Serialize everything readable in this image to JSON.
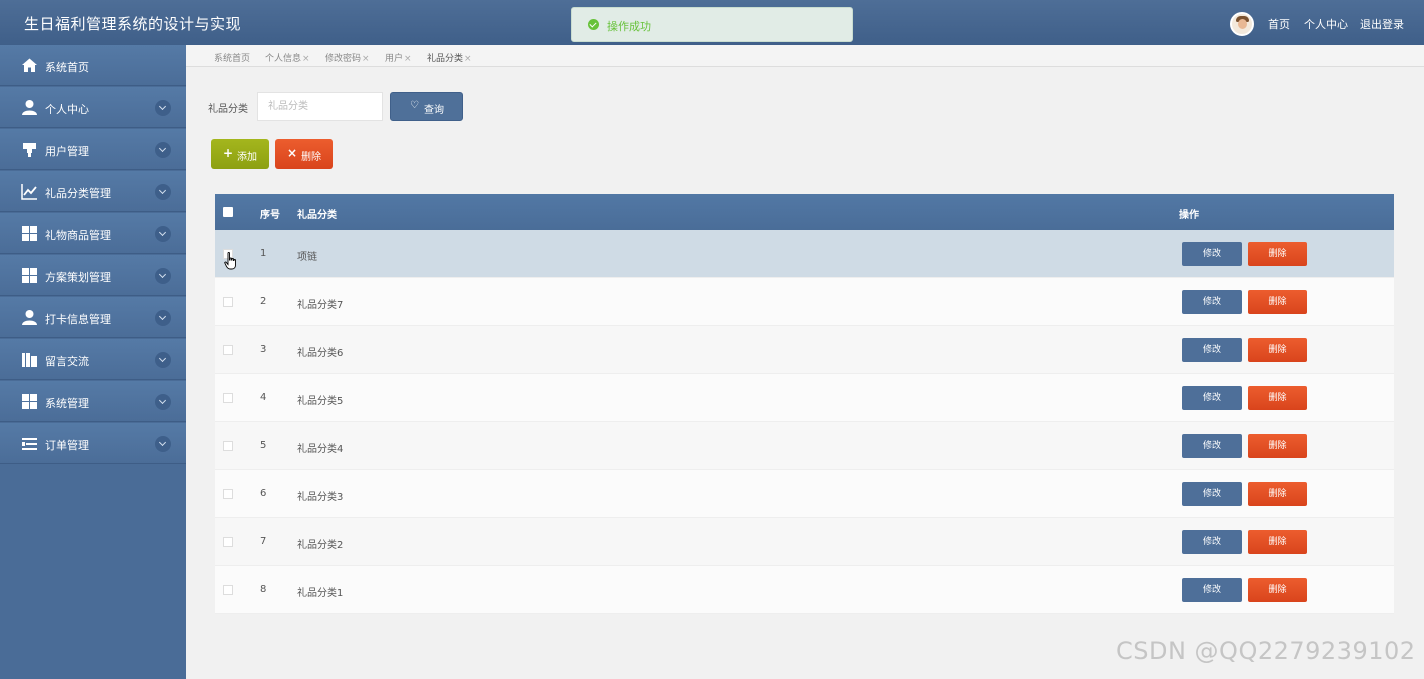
{
  "header": {
    "title": "生日福利管理系统的设计与实现",
    "nav": {
      "home": "首页",
      "profile": "个人中心",
      "logout": "退出登录"
    }
  },
  "toast": {
    "message": "操作成功",
    "color": "#67c23a"
  },
  "sidebar": {
    "items": [
      {
        "label": "系统首页",
        "icon": "home-icon",
        "expandable": false
      },
      {
        "label": "个人中心",
        "icon": "user-icon",
        "expandable": true
      },
      {
        "label": "用户管理",
        "icon": "user-manage-icon",
        "expandable": true
      },
      {
        "label": "礼品分类管理",
        "icon": "chart-icon",
        "expandable": true
      },
      {
        "label": "礼物商品管理",
        "icon": "grid-icon",
        "expandable": true
      },
      {
        "label": "方案策划管理",
        "icon": "grid-icon",
        "expandable": true
      },
      {
        "label": "打卡信息管理",
        "icon": "user-icon",
        "expandable": true
      },
      {
        "label": "留言交流",
        "icon": "message-icon",
        "expandable": true
      },
      {
        "label": "系统管理",
        "icon": "grid-icon",
        "expandable": true
      },
      {
        "label": "订单管理",
        "icon": "list-icon",
        "expandable": true
      }
    ]
  },
  "tabs": [
    {
      "label": "系统首页",
      "closable": false
    },
    {
      "label": "个人信息",
      "closable": true
    },
    {
      "label": "修改密码",
      "closable": true
    },
    {
      "label": "用户",
      "closable": true
    },
    {
      "label": "礼品分类",
      "closable": true,
      "active": true
    }
  ],
  "search": {
    "label": "礼品分类",
    "placeholder": "礼品分类",
    "value": "",
    "button": "查询"
  },
  "actions": {
    "add": "添加",
    "delete": "删除"
  },
  "table": {
    "columns": {
      "index": "序号",
      "category": "礼品分类",
      "operation": "操作"
    },
    "edit_label": "修改",
    "delete_label": "删除",
    "rows": [
      {
        "index": "1",
        "category": "项链"
      },
      {
        "index": "2",
        "category": "礼品分类7"
      },
      {
        "index": "3",
        "category": "礼品分类6"
      },
      {
        "index": "4",
        "category": "礼品分类5"
      },
      {
        "index": "5",
        "category": "礼品分类4"
      },
      {
        "index": "6",
        "category": "礼品分类3"
      },
      {
        "index": "7",
        "category": "礼品分类2"
      },
      {
        "index": "8",
        "category": "礼品分类1"
      }
    ]
  },
  "watermark": "CSDN @QQ2279239102"
}
